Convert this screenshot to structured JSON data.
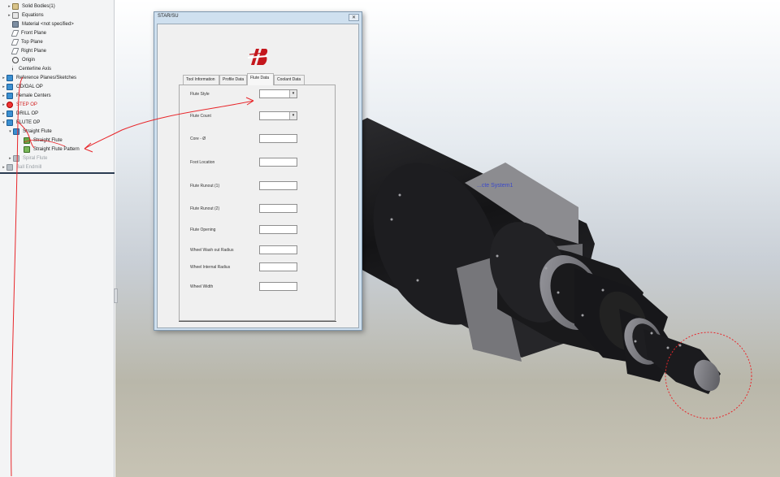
{
  "tree": {
    "items": [
      {
        "label": "Solid Bodies(1)",
        "icon": "solid-bodies-icon",
        "expander": "▸",
        "state": "normal"
      },
      {
        "label": "Equations",
        "icon": "equations-icon",
        "expander": "▸",
        "state": "normal"
      },
      {
        "label": "Material <not specified>",
        "icon": "material-icon",
        "expander": "",
        "state": "normal"
      },
      {
        "label": "Front Plane",
        "icon": "plane-icon",
        "expander": "",
        "state": "normal"
      },
      {
        "label": "Top Plane",
        "icon": "plane-icon",
        "expander": "",
        "state": "normal"
      },
      {
        "label": "Right Plane",
        "icon": "plane-icon",
        "expander": "",
        "state": "normal"
      },
      {
        "label": "Origin",
        "icon": "origin-icon",
        "expander": "",
        "state": "normal"
      },
      {
        "label": "Centerline Axis",
        "icon": "axis-icon",
        "expander": "",
        "state": "normal"
      },
      {
        "label": "Reference Planes/Sketches",
        "icon": "folder-icon",
        "expander": "▸",
        "state": "normal"
      },
      {
        "label": "OD/OAL OP",
        "icon": "folder-icon",
        "expander": "▸",
        "state": "normal"
      },
      {
        "label": "Female Centers",
        "icon": "folder-icon",
        "expander": "▸",
        "state": "normal"
      },
      {
        "label": "STEP OP",
        "icon": "error-icon",
        "expander": "▸",
        "state": "error"
      },
      {
        "label": "DRILL OP",
        "icon": "folder-icon",
        "expander": "▸",
        "state": "normal"
      },
      {
        "label": "FLUTE OP",
        "icon": "folder-icon",
        "expander": "▾",
        "state": "normal"
      },
      {
        "label": "Straight Flute",
        "icon": "folder-icon",
        "expander": "▾",
        "state": "normal"
      },
      {
        "label": "Straight Flute",
        "icon": "feature-icon",
        "expander": "",
        "state": "normal"
      },
      {
        "label": "Straight Flute Pattern",
        "icon": "pattern-icon",
        "expander": "",
        "state": "normal"
      },
      {
        "label": "Spiral Flute",
        "icon": "folder-grey-icon",
        "expander": "▸",
        "state": "grey"
      },
      {
        "label": "Ball Endmill",
        "icon": "folder-grey-icon",
        "expander": "▸",
        "state": "grey"
      }
    ]
  },
  "viewport": {
    "coord_label": "...cte System1"
  },
  "dialog": {
    "title": "STAR/SU",
    "close": "✕",
    "tabs": [
      {
        "label": "Tool Information",
        "active": false
      },
      {
        "label": "Profile Data",
        "active": false
      },
      {
        "label": "Flute Data",
        "active": true
      },
      {
        "label": "Coolant Data",
        "active": false
      }
    ],
    "fields": [
      {
        "label": "Flute Style",
        "kind": "select",
        "value": ""
      },
      {
        "label": "Flute Count",
        "kind": "select",
        "value": ""
      },
      {
        "label": "Core - Ø",
        "kind": "text",
        "value": ""
      },
      {
        "label": "Foot Location",
        "kind": "text",
        "value": ""
      },
      {
        "label": "Flute Runout (1)",
        "kind": "text",
        "value": ""
      },
      {
        "label": "Flute Runout (2)",
        "kind": "text",
        "value": ""
      },
      {
        "label": "Flute Opening",
        "kind": "text",
        "value": ""
      },
      {
        "label": "Wheel Wash out Radius",
        "kind": "text",
        "value": ""
      },
      {
        "label": "Wheel Internal Radius",
        "kind": "text",
        "value": ""
      },
      {
        "label": "Wheel Width",
        "kind": "text",
        "value": ""
      }
    ],
    "dropdown_arrow": "▾"
  },
  "colors": {
    "annotation": "#e8262a",
    "logo": "#c4161c",
    "tool_body": "#1b1b1d",
    "tool_face": "#6c6c70"
  }
}
